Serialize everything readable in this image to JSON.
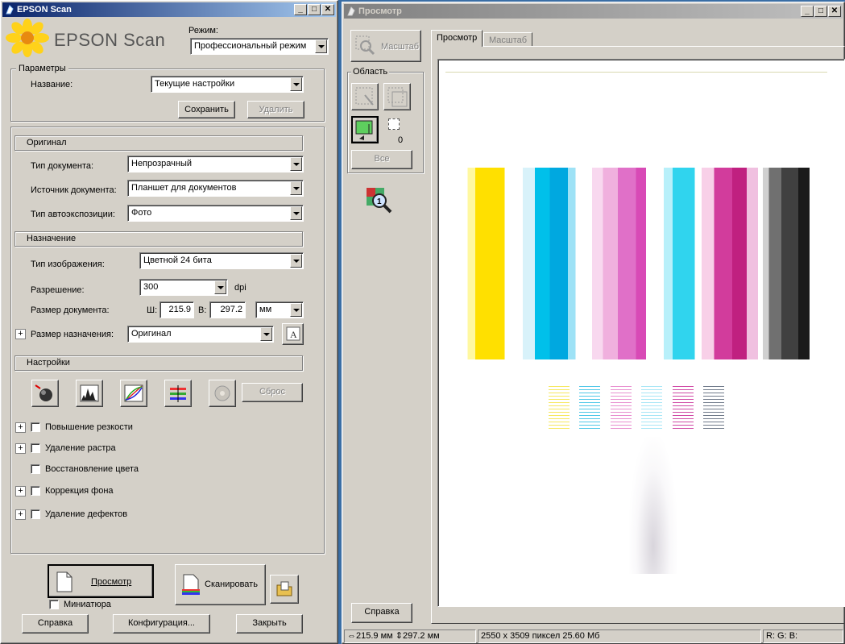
{
  "left_window": {
    "title": "EPSON Scan",
    "logo": "EPSON Scan",
    "mode_label": "Режим:",
    "mode_value": "Профессиональный режим",
    "params": {
      "group": "Параметры",
      "name_label": "Название:",
      "name_value": "Текущие настройки",
      "save": "Сохранить",
      "delete": "Удалить"
    },
    "original": {
      "section": "Оригинал",
      "doc_type_label": "Тип документа:",
      "doc_type_value": "Непрозрачный",
      "doc_source_label": "Источник документа:",
      "doc_source_value": "Планшет для документов",
      "auto_exp_label": "Тип автоэкспозиции:",
      "auto_exp_value": "Фото"
    },
    "destination": {
      "section": "Назначение",
      "image_type_label": "Тип изображения:",
      "image_type_value": "Цветной 24 бита",
      "resolution_label": "Разрешение:",
      "resolution_value": "300",
      "resolution_unit": "dpi",
      "doc_size_label": "Размер документа:",
      "w_label": "Ш:",
      "w_value": "215.9",
      "h_label": "В:",
      "h_value": "297.2",
      "unit_value": "мм",
      "target_size_label": "Размер назначения:",
      "target_size_value": "Оригинал"
    },
    "settings": {
      "section": "Настройки",
      "reset": "Сброс",
      "options": [
        {
          "label": "Повышение резкости",
          "expandable": true
        },
        {
          "label": "Удаление растра",
          "expandable": true
        },
        {
          "label": "Восстановление цвета",
          "expandable": false
        },
        {
          "label": "Коррекция фона",
          "expandable": true
        },
        {
          "label": "Удаление дефектов",
          "expandable": true
        }
      ]
    },
    "preview_btn": "Просмотр",
    "scan_btn": "Сканировать",
    "thumbnail_label": "Миниатюра",
    "help": "Справка",
    "config": "Конфигурация...",
    "close": "Закрыть"
  },
  "right_window": {
    "title": "Просмотр",
    "zoom_btn": "Масштаб",
    "area_group": "Область",
    "area_count": "0",
    "all_btn": "Все",
    "tabs": [
      "Просмотр",
      "Масштаб"
    ],
    "help": "Справка",
    "status_size": "215.9 мм",
    "status_height": "297.2 мм",
    "status_pixels": "2550 x 3509 пиксел 25.60 Мб",
    "status_rgb": "R: G: B:"
  },
  "colors": {
    "window_bg": "#d4d0c8",
    "title_active": "#0a246a",
    "desktop": "#3a6ea5",
    "yellow": "#ffe000",
    "cyan": "#00b4e6",
    "magenta": "#d2329b",
    "black": "#2a2a2a"
  }
}
